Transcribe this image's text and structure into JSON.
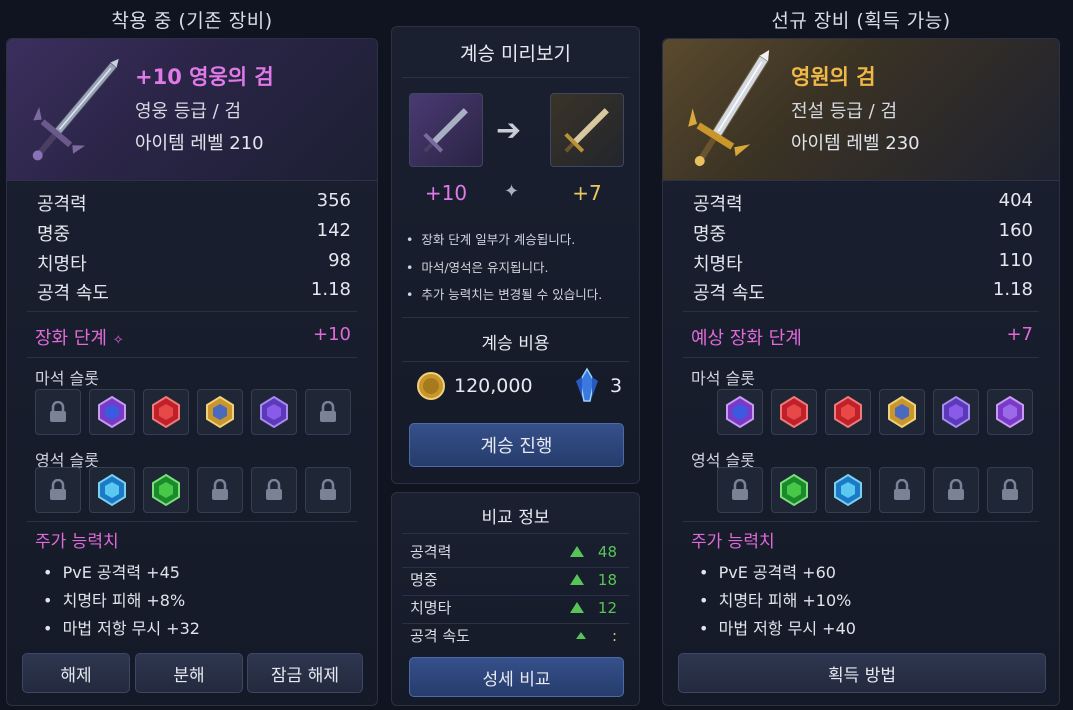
{
  "left": {
    "column_title": "착용 중 (기존 장비)",
    "item_name": "+10 영웅의 검",
    "item_grade": "영웅 등급 / 검",
    "item_level": "아이템 레벨 210",
    "stats": [
      {
        "label": "공격력",
        "value": "356"
      },
      {
        "label": "명중",
        "value": "142"
      },
      {
        "label": "치명타",
        "value": "98"
      },
      {
        "label": "공격 속도",
        "value": "1.18"
      }
    ],
    "enhance_label": "장화 단계",
    "enhance_value": "+10",
    "rune_label": "마석 슬롯",
    "soul_label": "영석 슬롯",
    "extra_label": "주가 능력치",
    "extras": [
      "PvE 공격력 +45",
      "치명타 피해 +8%",
      "마법 저항 무시 +32"
    ],
    "buttons": {
      "unequip": "해제",
      "dismantle": "분해",
      "unlock": "잠금 해제"
    }
  },
  "right": {
    "column_title": "선규 장비 (획득 가능)",
    "item_name": "영원의 검",
    "item_grade": "전설 등급 / 검",
    "item_level": "아이템 레벨 230",
    "stats": [
      {
        "label": "공격력",
        "value": "404"
      },
      {
        "label": "명중",
        "value": "160"
      },
      {
        "label": "치명타",
        "value": "110"
      },
      {
        "label": "공격 속도",
        "value": "1.18"
      }
    ],
    "enhance_label": "예상 장화 단계",
    "enhance_value": "+7",
    "rune_label": "마석 슬롯",
    "soul_label": "영석 슬롯",
    "extra_label": "주가 능력치",
    "extras": [
      "PvE 공격력 +60",
      "치명타 피해 +10%",
      "마법 저항 무시 +40"
    ],
    "buttons": {
      "acquire": "획득 방법"
    }
  },
  "preview": {
    "title": "계승 미리보기",
    "from_level": "+10",
    "to_level": "+7",
    "notes": [
      "장화 단계 일부가 계승됩니다.",
      "마석/영석은 유지됩니다.",
      "추가 능력치는 변경될 수 있습니다."
    ],
    "cost_title": "계승 비용",
    "gold_cost": "120,000",
    "crystal_cost": "3",
    "button": "계승 진행"
  },
  "compare": {
    "title": "비교 정보",
    "rows": [
      {
        "label": "공격력",
        "delta": "48"
      },
      {
        "label": "명중",
        "delta": "18"
      },
      {
        "label": "치명타",
        "delta": "12"
      },
      {
        "label": "공격 속도",
        "delta": ":"
      }
    ],
    "button": "성세 비교"
  },
  "colors": {
    "hero_pink": "#e07ae8",
    "legend_gold": "#f0b848",
    "enhance_pink": "#e06ad8",
    "up_green": "#58c458",
    "to_gold": "#e8c860"
  }
}
